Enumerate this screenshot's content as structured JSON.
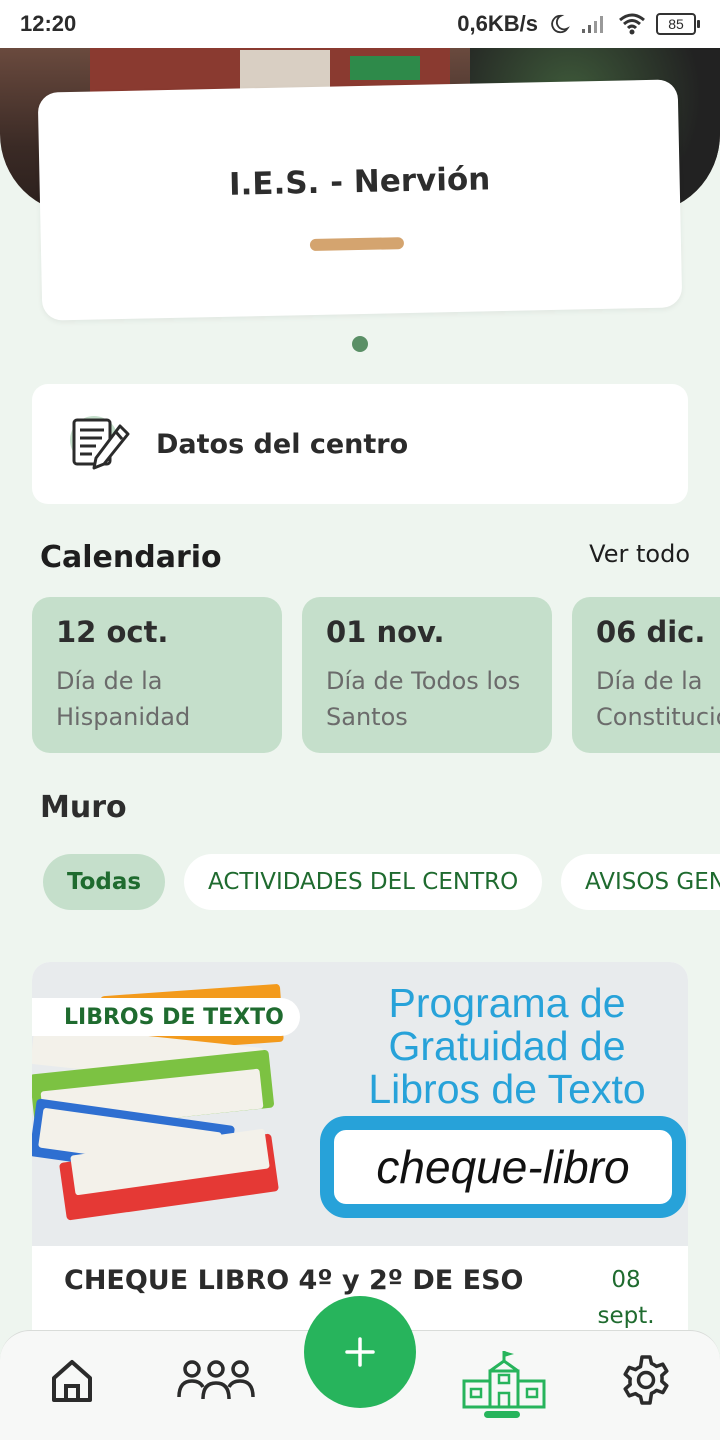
{
  "status_bar": {
    "time": "12:20",
    "speed": "0,6KB/s",
    "battery": "85",
    "icons": [
      "moon-icon",
      "signal-icon",
      "wifi-icon",
      "battery-icon"
    ]
  },
  "school": {
    "name": "I.E.S. - Nervión",
    "carousel_pages": 1,
    "carousel_active": 1
  },
  "datos": {
    "label": "Datos del centro",
    "icon": "document-edit-icon"
  },
  "calendar": {
    "title": "Calendario",
    "see_all": "Ver todo",
    "events": [
      {
        "date": "12 oct.",
        "description": "Día de la Hispanidad"
      },
      {
        "date": "01 nov.",
        "description": "Día de Todos los Santos"
      },
      {
        "date": "06 dic.",
        "description": "Día de la Constitución"
      }
    ]
  },
  "muro": {
    "title": "Muro",
    "filters": [
      "Todas",
      "ACTIVIDADES DEL CENTRO",
      "AVISOS GENERALES"
    ],
    "active_filter": "Todas"
  },
  "post": {
    "tag": "LIBROS DE TEXTO",
    "image_text": {
      "line1": "Programa de",
      "line2": "Gratuidad de",
      "line3": "Libros de Texto",
      "box": "cheque-libro"
    },
    "title": "CHEQUE LIBRO 4º y 2º DE ESO",
    "date_day": "08",
    "date_month": "sept."
  },
  "bottom_nav": {
    "items": [
      "home-icon",
      "people-icon",
      "school-icon",
      "settings-icon"
    ],
    "active": "school-icon",
    "fab_label": "+"
  },
  "colors": {
    "accent": "#27b45c",
    "dark_green": "#1f6b2f",
    "card_green": "#c5dfcb",
    "background": "#eef5ef",
    "tan": "#d4a46f",
    "promo_blue": "#27a2d9"
  }
}
